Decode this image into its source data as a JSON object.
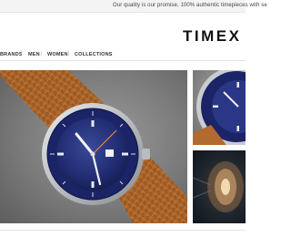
{
  "promo": {
    "text": "Our quality is our promise, 100% authentic timepieces with se"
  },
  "brand": {
    "logo": "TIMEX"
  },
  "nav": {
    "items": [
      {
        "label": "BRANDS"
      },
      {
        "label": "MEN"
      },
      {
        "label": "WOMEN"
      },
      {
        "label": "COLLECTIONS"
      }
    ],
    "separator": "|"
  },
  "colors": {
    "accent": "#1f2a6e",
    "strap": "#b26a2e",
    "case": "#c9ccd0"
  },
  "icons": [
    "watch-hero-image",
    "watch-closeup-image",
    "crown-closeup-image"
  ]
}
